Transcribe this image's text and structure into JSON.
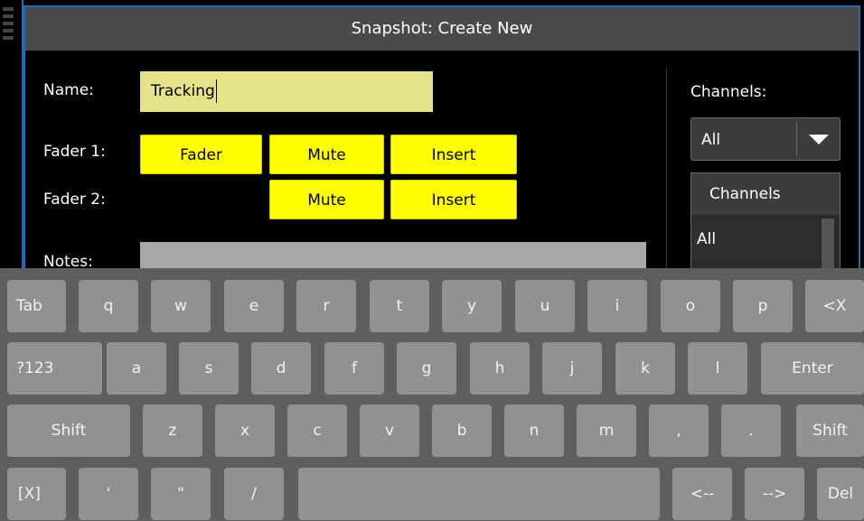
{
  "dialog": {
    "title": "Snapshot: Create New",
    "name_label": "Name:",
    "name_value": "Tracking",
    "fader1_label": "Fader 1:",
    "fader2_label": "Fader 2:",
    "notes_label": "Notes:",
    "fader1_buttons": [
      "Fader",
      "Mute",
      "Insert"
    ],
    "fader2_buttons": [
      "Mute",
      "Insert"
    ],
    "channels_label": "Channels:",
    "channels_selected": "All",
    "channels_list_header": "Channels",
    "channels_list_items": [
      "All"
    ]
  },
  "keyboard": {
    "row1": [
      "Tab",
      "q",
      "w",
      "e",
      "r",
      "t",
      "y",
      "u",
      "i",
      "o",
      "p",
      "<X"
    ],
    "row2": [
      "?123",
      "a",
      "s",
      "d",
      "f",
      "g",
      "h",
      "j",
      "k",
      "l",
      "Enter"
    ],
    "row3": [
      "Shift",
      "z",
      "x",
      "c",
      "v",
      "b",
      "n",
      "m",
      ",",
      ".",
      "Shift"
    ],
    "row4": [
      "[X]",
      "'",
      "\"",
      "/",
      "",
      "<--",
      "-->",
      "Del"
    ]
  },
  "colors": {
    "title_bar": "#4a4a4a",
    "button_active": "#ffff00",
    "name_field": "#e6e28a",
    "dialog_border": "#1f6fb5",
    "keyboard_bg": "#5e5e5e",
    "key_bg": "#919191"
  }
}
